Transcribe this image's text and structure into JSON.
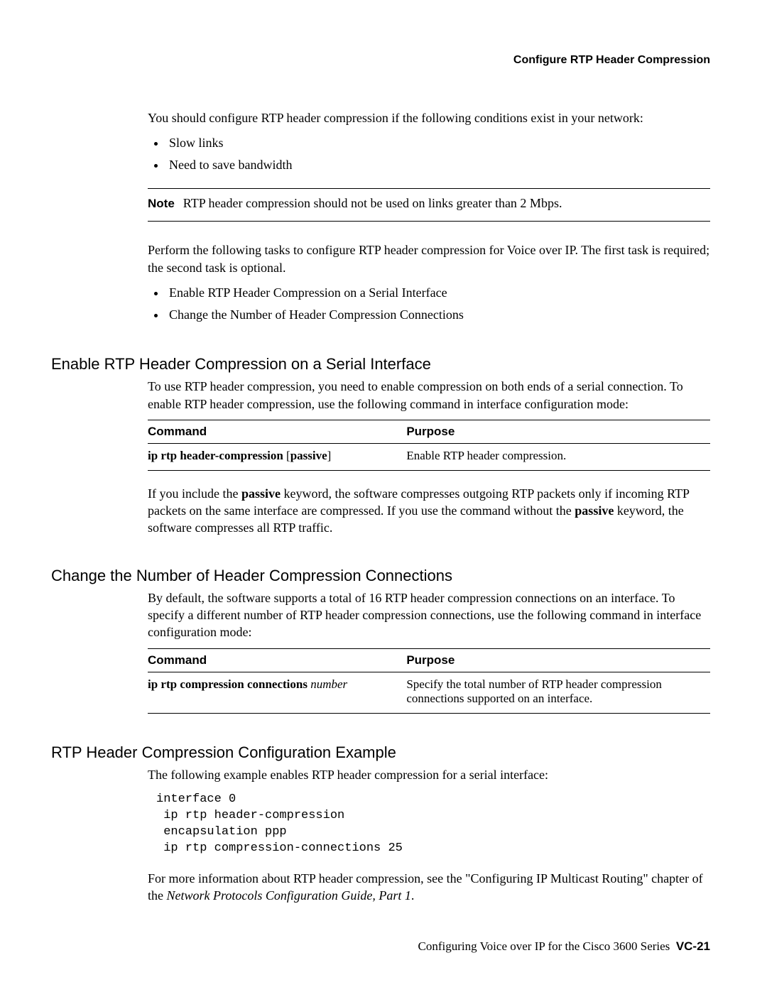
{
  "header": {
    "running_title": "Configure RTP Header Compression"
  },
  "intro": {
    "lead": "You should configure RTP header compression if the following conditions exist in your network:",
    "bullets": [
      "Slow links",
      "Need to save bandwidth"
    ]
  },
  "note": {
    "label": "Note",
    "text": "RTP header compression should not be used on links greater than 2 Mbps."
  },
  "tasks": {
    "lead": "Perform the following tasks to configure RTP header compression for Voice over IP. The first task is required; the second task is optional.",
    "bullets": [
      "Enable RTP Header Compression on a Serial Interface",
      "Change the Number of Header Compression Connections"
    ]
  },
  "section1": {
    "heading": "Enable RTP Header Compression on a Serial Interface",
    "body1": "To use RTP header compression, you need to enable compression on both ends of a serial connection. To enable RTP header compression, use the following command in interface configuration mode:",
    "table": {
      "h_command": "Command",
      "h_purpose": "Purpose",
      "cmd_bold": "ip rtp header-compression",
      "cmd_opt": " [",
      "cmd_opt_kw": "passive",
      "cmd_opt_close": "]",
      "purpose": "Enable RTP header compression."
    },
    "body2a": "If you include the ",
    "body2_kw1": "passive",
    "body2b": " keyword, the software compresses outgoing RTP packets only if incoming RTP packets on the same interface are compressed. If you use the command without the ",
    "body2_kw2": "passive",
    "body2c": " keyword, the software compresses all RTP traffic."
  },
  "section2": {
    "heading": "Change the Number of Header Compression Connections",
    "body1": "By default, the software supports a total of 16 RTP header compression connections on an interface. To specify a different number of RTP header compression connections, use the following command in interface configuration mode:",
    "table": {
      "h_command": "Command",
      "h_purpose": "Purpose",
      "cmd_bold": "ip rtp compression connections",
      "cmd_arg": " number",
      "purpose": "Specify the total number of RTP header compression connections supported on an interface."
    }
  },
  "section3": {
    "heading": "RTP Header Compression Configuration Example",
    "body1": "The following example enables RTP header compression for a serial interface:",
    "code": "interface 0\n ip rtp header-compression\n encapsulation ppp\n ip rtp compression-connections 25",
    "body2a": "For more information about RTP header compression, see the \"Configuring IP Multicast Routing\" chapter of the ",
    "body2_em": "Network Protocols Configuration Guide, Part 1",
    "body2b": "."
  },
  "footer": {
    "title": "Configuring Voice over IP for the Cisco 3600 Series",
    "page": "VC-21"
  }
}
